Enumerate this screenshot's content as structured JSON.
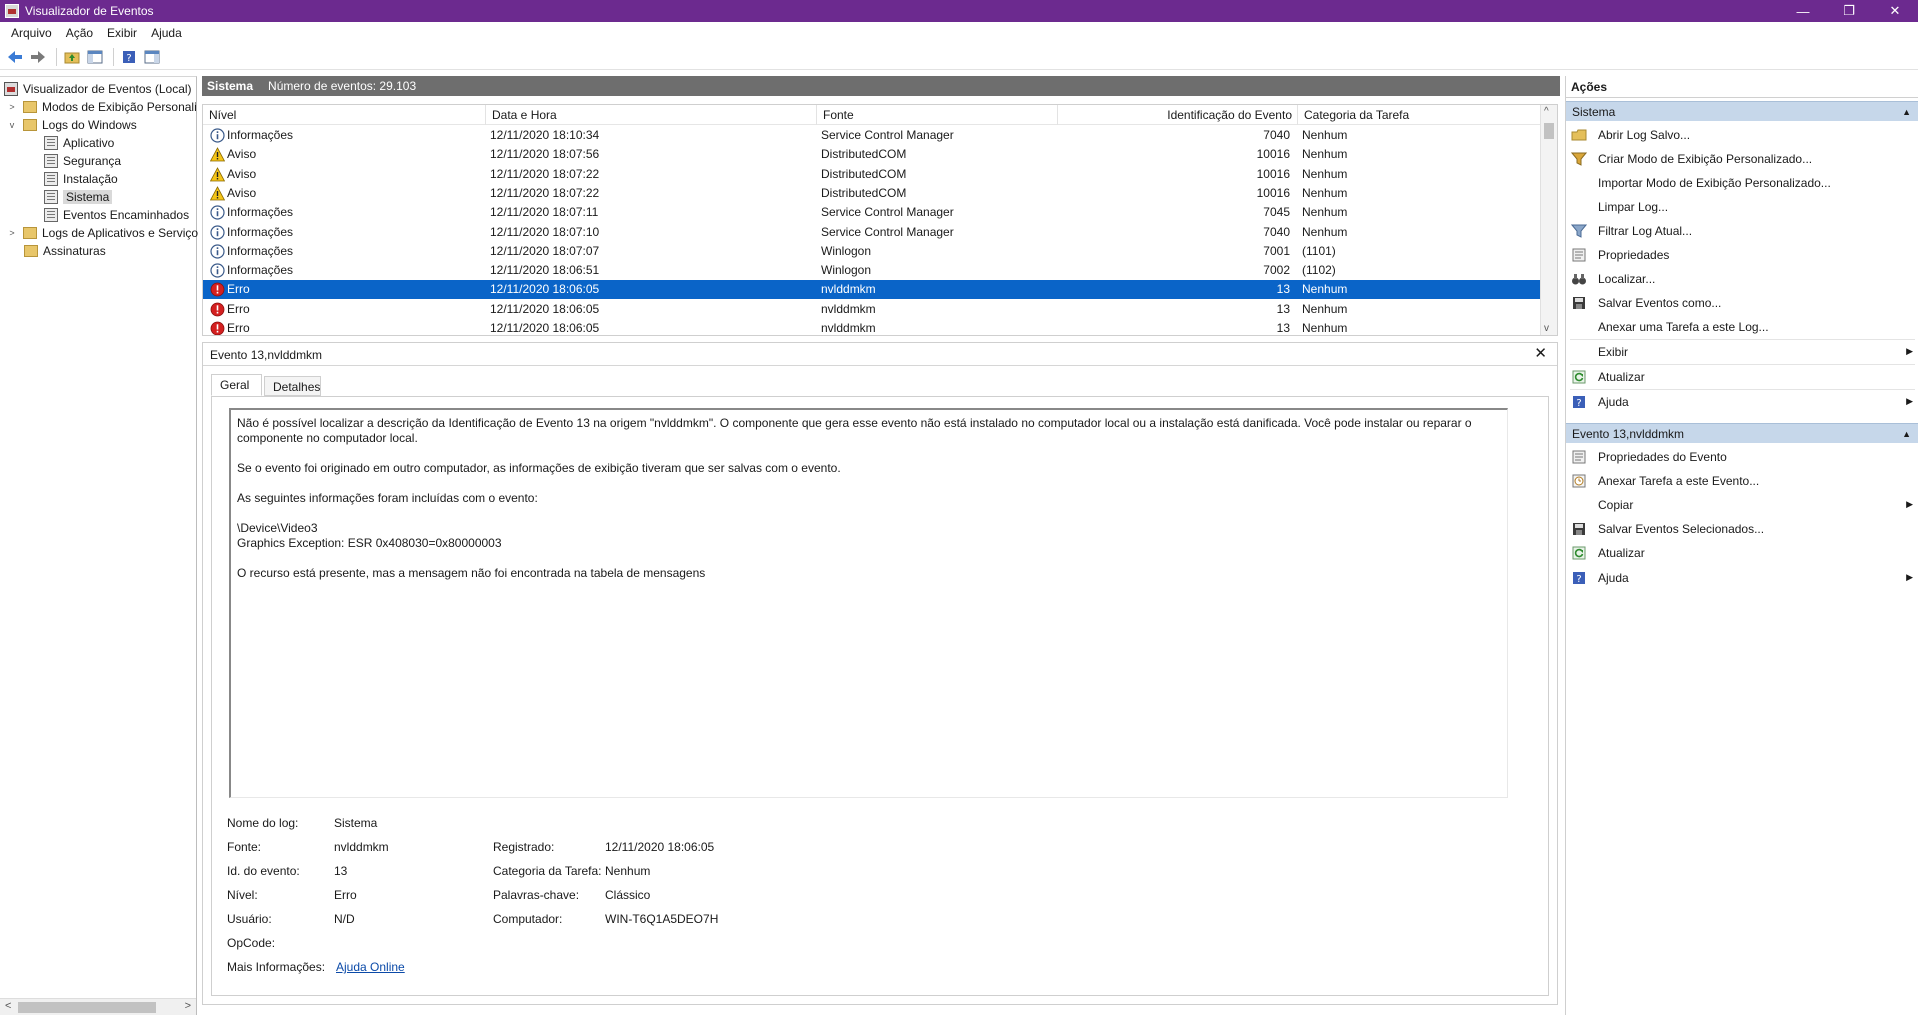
{
  "window": {
    "title": "Visualizador de Eventos",
    "minimize": "—",
    "maximize": "❐",
    "close": "✕"
  },
  "menu": [
    "Arquivo",
    "Ação",
    "Exibir",
    "Ajuda"
  ],
  "tree": {
    "root": "Visualizador de Eventos (Local)",
    "custom_views": "Modos de Exibição Personali",
    "windows_logs": "Logs do Windows",
    "aplicativo": "Aplicativo",
    "seguranca": "Segurança",
    "instalacao": "Instalação",
    "sistema": "Sistema",
    "encaminhados": "Eventos Encaminhados",
    "apps_services": "Logs de Aplicativos e Serviço",
    "assinaturas": "Assinaturas"
  },
  "center_header": {
    "log_name": "Sistema",
    "count_text": "Número de eventos: 29.103"
  },
  "columns": {
    "nivel": "Nível",
    "data": "Data e Hora",
    "fonte": "Fonte",
    "id": "Identificação do Evento",
    "categoria": "Categoria da Tarefa"
  },
  "events": [
    {
      "level": "info",
      "nivel": "Informações",
      "data": "12/11/2020 18:10:34",
      "fonte": "Service Control Manager",
      "id": "7040",
      "categoria": "Nenhum"
    },
    {
      "level": "warn",
      "nivel": "Aviso",
      "data": "12/11/2020 18:07:56",
      "fonte": "DistributedCOM",
      "id": "10016",
      "categoria": "Nenhum"
    },
    {
      "level": "warn",
      "nivel": "Aviso",
      "data": "12/11/2020 18:07:22",
      "fonte": "DistributedCOM",
      "id": "10016",
      "categoria": "Nenhum"
    },
    {
      "level": "warn",
      "nivel": "Aviso",
      "data": "12/11/2020 18:07:22",
      "fonte": "DistributedCOM",
      "id": "10016",
      "categoria": "Nenhum"
    },
    {
      "level": "info",
      "nivel": "Informações",
      "data": "12/11/2020 18:07:11",
      "fonte": "Service Control Manager",
      "id": "7045",
      "categoria": "Nenhum"
    },
    {
      "level": "info",
      "nivel": "Informações",
      "data": "12/11/2020 18:07:10",
      "fonte": "Service Control Manager",
      "id": "7040",
      "categoria": "Nenhum"
    },
    {
      "level": "info",
      "nivel": "Informações",
      "data": "12/11/2020 18:07:07",
      "fonte": "Winlogon",
      "id": "7001",
      "categoria": "(1101)"
    },
    {
      "level": "info",
      "nivel": "Informações",
      "data": "12/11/2020 18:06:51",
      "fonte": "Winlogon",
      "id": "7002",
      "categoria": "(1102)"
    },
    {
      "level": "error",
      "nivel": "Erro",
      "data": "12/11/2020 18:06:05",
      "fonte": "nvlddmkm",
      "id": "13",
      "categoria": "Nenhum",
      "selected": true
    },
    {
      "level": "error",
      "nivel": "Erro",
      "data": "12/11/2020 18:06:05",
      "fonte": "nvlddmkm",
      "id": "13",
      "categoria": "Nenhum"
    },
    {
      "level": "error",
      "nivel": "Erro",
      "data": "12/11/2020 18:06:05",
      "fonte": "nvlddmkm",
      "id": "13",
      "categoria": "Nenhum"
    }
  ],
  "detail": {
    "title": "Evento 13,nvlddmkm",
    "close": "✕",
    "tabs": {
      "geral": "Geral",
      "detalhes": "Detalhes"
    },
    "description": {
      "p1": "Não é possível localizar a descrição da Identificação de Evento 13 na origem \"nvlddmkm\". O componente que gera esse evento não está instalado no computador local ou a instalação está danificada. Você pode instalar ou reparar o componente no computador local.",
      "p2": "Se o evento foi originado em outro computador, as informações de exibição tiveram que ser salvas com o evento.",
      "p3": "As seguintes informações foram incluídas com o evento:",
      "line1": "\\Device\\Video3",
      "line2": "Graphics Exception: ESR 0x408030=0x80000003",
      "p4": "O recurso está presente, mas a mensagem não foi encontrada na tabela de mensagens"
    },
    "labels": {
      "log_name": "Nome do log:",
      "source": "Fonte:",
      "event_id": "Id. do evento:",
      "level": "Nível:",
      "user": "Usuário:",
      "opcode": "OpCode:",
      "more_info": "Mais Informações:",
      "logged": "Registrado:",
      "task_category": "Categoria da Tarefa:",
      "keywords": "Palavras-chave:",
      "computer": "Computador:"
    },
    "values": {
      "log_name": "Sistema",
      "source": "nvlddmkm",
      "event_id": "13",
      "level": "Erro",
      "user": "N/D",
      "more_info_link": "Ajuda Online",
      "logged": "12/11/2020 18:06:05",
      "task_category": "Nenhum",
      "keywords": "Clássico",
      "computer": "WIN-T6Q1A5DEO7H"
    }
  },
  "actions": {
    "header": "Ações",
    "section1": "Sistema",
    "items1": [
      "Abrir Log Salvo...",
      "Criar Modo de Exibição Personalizado...",
      "Importar Modo de Exibição Personalizado...",
      "Limpar Log...",
      "Filtrar Log Atual...",
      "Propriedades",
      "Localizar...",
      "Salvar Eventos como...",
      "Anexar uma Tarefa a este Log...",
      "Exibir",
      "Atualizar",
      "Ajuda"
    ],
    "section2": "Evento 13,nvlddmkm",
    "items2": [
      "Propriedades do Evento",
      "Anexar Tarefa a este Evento...",
      "Copiar",
      "Salvar Eventos Selecionados...",
      "Atualizar",
      "Ajuda"
    ]
  }
}
